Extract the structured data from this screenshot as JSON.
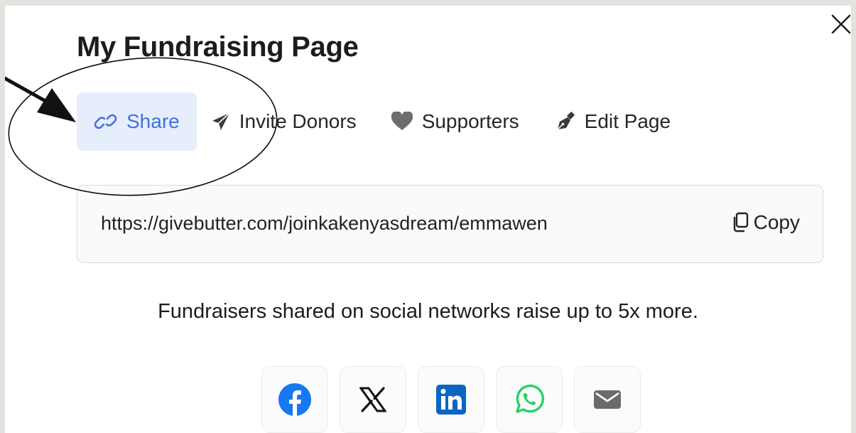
{
  "modal": {
    "title": "My Fundraising Page"
  },
  "tabs": [
    {
      "label": "Share",
      "icon": "link-icon",
      "active": true
    },
    {
      "label": "Invite Donors",
      "icon": "paper-plane-icon",
      "active": false
    },
    {
      "label": "Supporters",
      "icon": "heart-icon",
      "active": false
    },
    {
      "label": "Edit Page",
      "icon": "pen-icon",
      "active": false
    }
  ],
  "share": {
    "url": "https://givebutter.com/joinkakenyasdream/emmawen",
    "copy_label": "Copy",
    "promo_text": "Fundraisers shared on social networks raise up to 5x more."
  },
  "social_buttons": [
    {
      "icon": "facebook-icon",
      "color": "#1877f2"
    },
    {
      "icon": "x-icon",
      "color": "#111111"
    },
    {
      "icon": "linkedin-icon",
      "color": "#0a66c2"
    },
    {
      "icon": "whatsapp-icon",
      "color": "#25d366"
    },
    {
      "icon": "email-icon",
      "color": "#6b6b6b"
    }
  ],
  "colors": {
    "active_tab_bg": "#e6eefc",
    "accent": "#3f72de"
  }
}
